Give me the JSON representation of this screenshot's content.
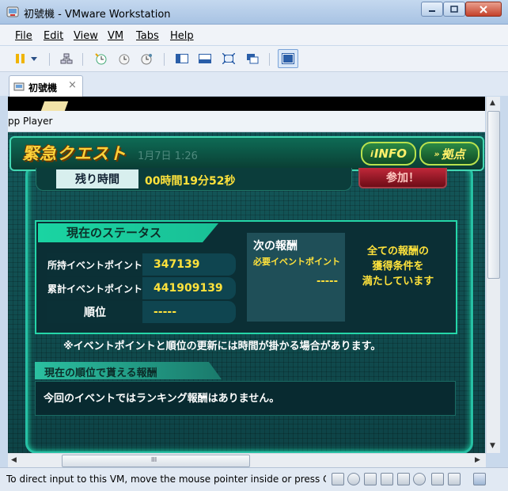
{
  "window": {
    "title": "初號機 - VMware Workstation"
  },
  "menu": {
    "items": [
      "File",
      "Edit",
      "View",
      "VM",
      "Tabs",
      "Help"
    ]
  },
  "tab": {
    "label": "初號機",
    "close": "×"
  },
  "guest": {
    "app_title": "pp Player",
    "quest": {
      "title": "緊急クエスト",
      "date_ghost": "1月7日 1:26",
      "info_button": "INFO",
      "base_button": "拠点",
      "remaining_label": "残り時間",
      "remaining_value": "00時間19分52秒",
      "join_button": "参加！"
    },
    "status": {
      "heading": "現在のステータス",
      "rows": [
        {
          "label": "所持イベントポイント",
          "value": "347139"
        },
        {
          "label": "累計イベントポイント",
          "value": "441909139"
        },
        {
          "label": "順位",
          "value": "-----"
        }
      ],
      "next_reward_title": "次の報酬",
      "next_reward_sub": "必要イベントポイント",
      "next_reward_value": "-----",
      "reward_message_lines": [
        "全ての報酬の",
        "獲得条件を",
        "満たしています"
      ]
    },
    "note": "※イベントポイントと順位の更新には時間が掛かる場合があります。",
    "rank": {
      "heading": "現在の順位で貰える報酬",
      "message": "今回のイベントではランキング報酬はありません。"
    }
  },
  "scroll": {
    "h_grip": "III"
  },
  "statusbar": {
    "text": "To direct input to this VM, move the mouse pointer inside or press Ctrl+G."
  },
  "colors": {
    "accent_yellow": "#ffe23b",
    "teal_frame": "#25d6a8",
    "title_bar": "#c4d8ef"
  }
}
